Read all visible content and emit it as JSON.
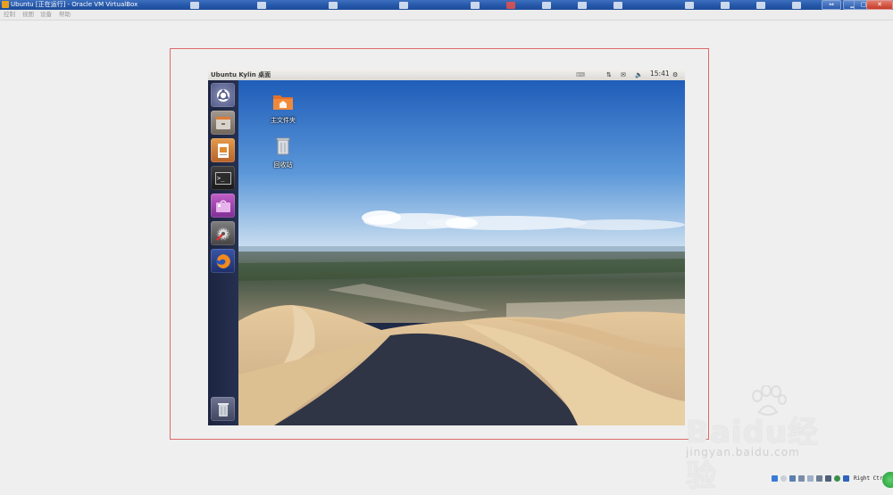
{
  "host_window": {
    "title": "Ubuntu [正在运行] - Oracle VM VirtualBox",
    "menu": [
      "控制",
      "视图",
      "设备",
      "帮助"
    ],
    "controls": {
      "restore": "⇔",
      "minimize": "▁",
      "maximize": "▢",
      "close": "✕"
    }
  },
  "guest": {
    "panel_title": "Ubuntu Kylin 桌面",
    "clock": "15:41",
    "indicators": [
      "keyboard-icon",
      "network-icon",
      "mail-icon",
      "volume-icon",
      "power-icon"
    ],
    "launcher": [
      "dash-home",
      "files",
      "libreoffice-impress",
      "terminal",
      "software-center",
      "system-settings",
      "firefox",
      "trash"
    ],
    "desktop_icons": [
      {
        "label": "主文件夹",
        "icon": "folder-icon"
      },
      {
        "label": "回收站",
        "icon": "trash-icon"
      }
    ]
  },
  "statusbar": {
    "host_key": "Right Ctrl"
  },
  "watermark": {
    "logo": "Baidu经验",
    "url": "jingyan.baidu.com"
  },
  "colors": {
    "frame_highlight": "#e06a6a",
    "launcher_bg": "#1f2844",
    "title_blue": "#2456a8"
  }
}
